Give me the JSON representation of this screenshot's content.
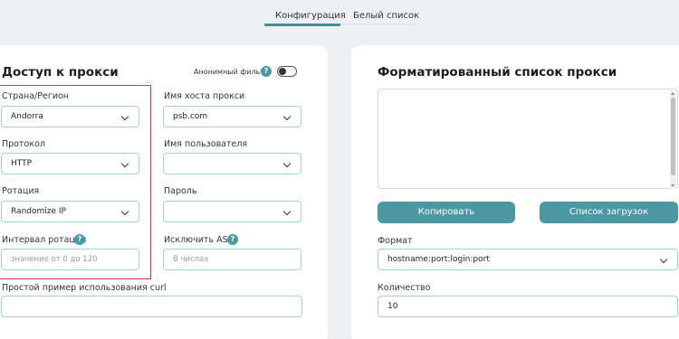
{
  "tabs": {
    "config": "Конфигурация",
    "whitelist": "Белый список"
  },
  "proxy_access": {
    "title": "Доступ к прокси",
    "anon_filter_label": "Анонимный фильтр",
    "anon_filter_on": false,
    "country_label": "Страна/Регион",
    "country_value": "Andorra",
    "protocol_label": "Протокол",
    "protocol_value": "HTTP",
    "rotation_label": "Ротация",
    "rotation_value": "Randomize IP",
    "interval_label": "Интервал ротации",
    "interval_placeholder": "значение от 0 до 120",
    "hostname_label": "Имя хоста прокси",
    "hostname_value": "psb.com",
    "username_label": "Имя пользователя",
    "username_value": "",
    "password_label": "Пароль",
    "password_value": "",
    "exclude_asn_label": "Исключить ASN",
    "exclude_asn_placeholder": "В числах",
    "curl_label": "Простой пример использования curl"
  },
  "formatted_list": {
    "title": "Форматированный список прокси",
    "copy_button": "Копировать",
    "downloads_button": "Список загрузок",
    "format_label": "Формат",
    "format_value": "hostname:port:login:port",
    "quantity_label": "Количество",
    "quantity_value": "10"
  },
  "colors": {
    "accent": "#4b97a2",
    "highlight_border": "#d9363e",
    "field_border": "#9fd3d8"
  }
}
